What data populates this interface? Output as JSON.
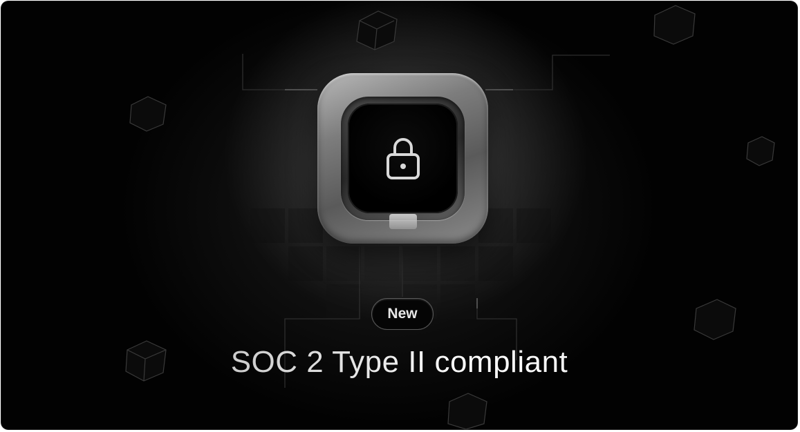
{
  "banner": {
    "badge_label": "New",
    "headline": "SOC 2 Type II compliant",
    "icon": "lock-icon",
    "colors": {
      "background": "#020202",
      "badge_border": "#5a5a5a",
      "text": "#f2f2f2"
    }
  }
}
